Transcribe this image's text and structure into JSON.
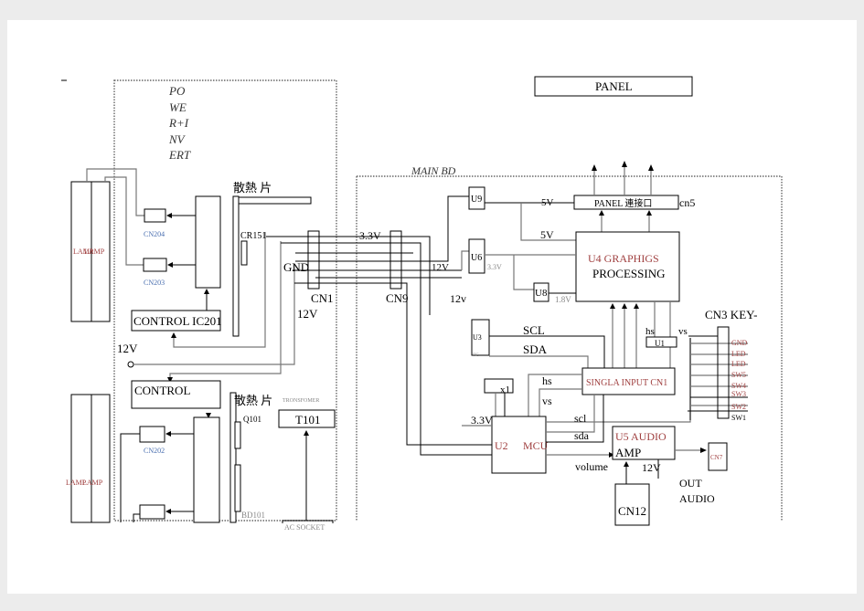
{
  "left_board": {
    "power_label_lines": [
      "PO",
      "WE",
      "R+I",
      "NV",
      "ERT"
    ],
    "lamp": "LAMP",
    "cn204": "CN204",
    "cn203": "CN203",
    "cn202": "CN202",
    "control_ic": "CONTROL  IC201",
    "control": "CONTROL",
    "heatsink": "散熱 片",
    "cr151": "CR151",
    "q101": "Q101",
    "bd101": "BD101",
    "transformer_label": "TRONSFOMER",
    "t101": "T101",
    "ac_socket": "AC     SOCKET",
    "v12": "12V",
    "gnd": "GND",
    "cn1": "CN1",
    "v12_cn1": "12V"
  },
  "main_board": {
    "title": "MAIN  BD",
    "panel": "PANEL",
    "panel_connector": "PANEL  連接口",
    "cn5": "cn5",
    "u9": "U9",
    "u6": "U6",
    "u8": "U8",
    "u4_line1": "U4     GRAPHIGS",
    "u4_line2": "PROCESSING",
    "v5a": "5V",
    "v5b": "5V",
    "v33_u6": "3.3V",
    "v18": "1.8V",
    "v33": "3.3V",
    "v12_cn9": "12V",
    "v12_low": "12v",
    "cn9": "CN9",
    "u3": "U3",
    "u3_sub": "IIC",
    "scl": "SCL",
    "sda": "SDA",
    "x1": "x1",
    "hs": "hs",
    "vs": "vs",
    "hs2": "hs",
    "vs2": "vs",
    "u1": "U1",
    "singla_input": "SINGLA  INPUT  CN1",
    "u2": "U2",
    "mcu": "MCU",
    "v33_mcu": "3.3V",
    "scl_l": "scl",
    "sda_l": "sda",
    "volume": "volume",
    "u5_line1": "U5    AUDIO",
    "u5_line2": "AMP",
    "v12_amp": "12V",
    "cn7": "CN7",
    "out_audio_1": "OUT",
    "out_audio_2": "AUDIO",
    "cn12": "CN12",
    "cn3": "CN3 KEY-",
    "cn3_pins": [
      "GND",
      "LED",
      "LED",
      "SW5",
      "SW4",
      "SW3",
      "SW2",
      "SW1"
    ]
  }
}
